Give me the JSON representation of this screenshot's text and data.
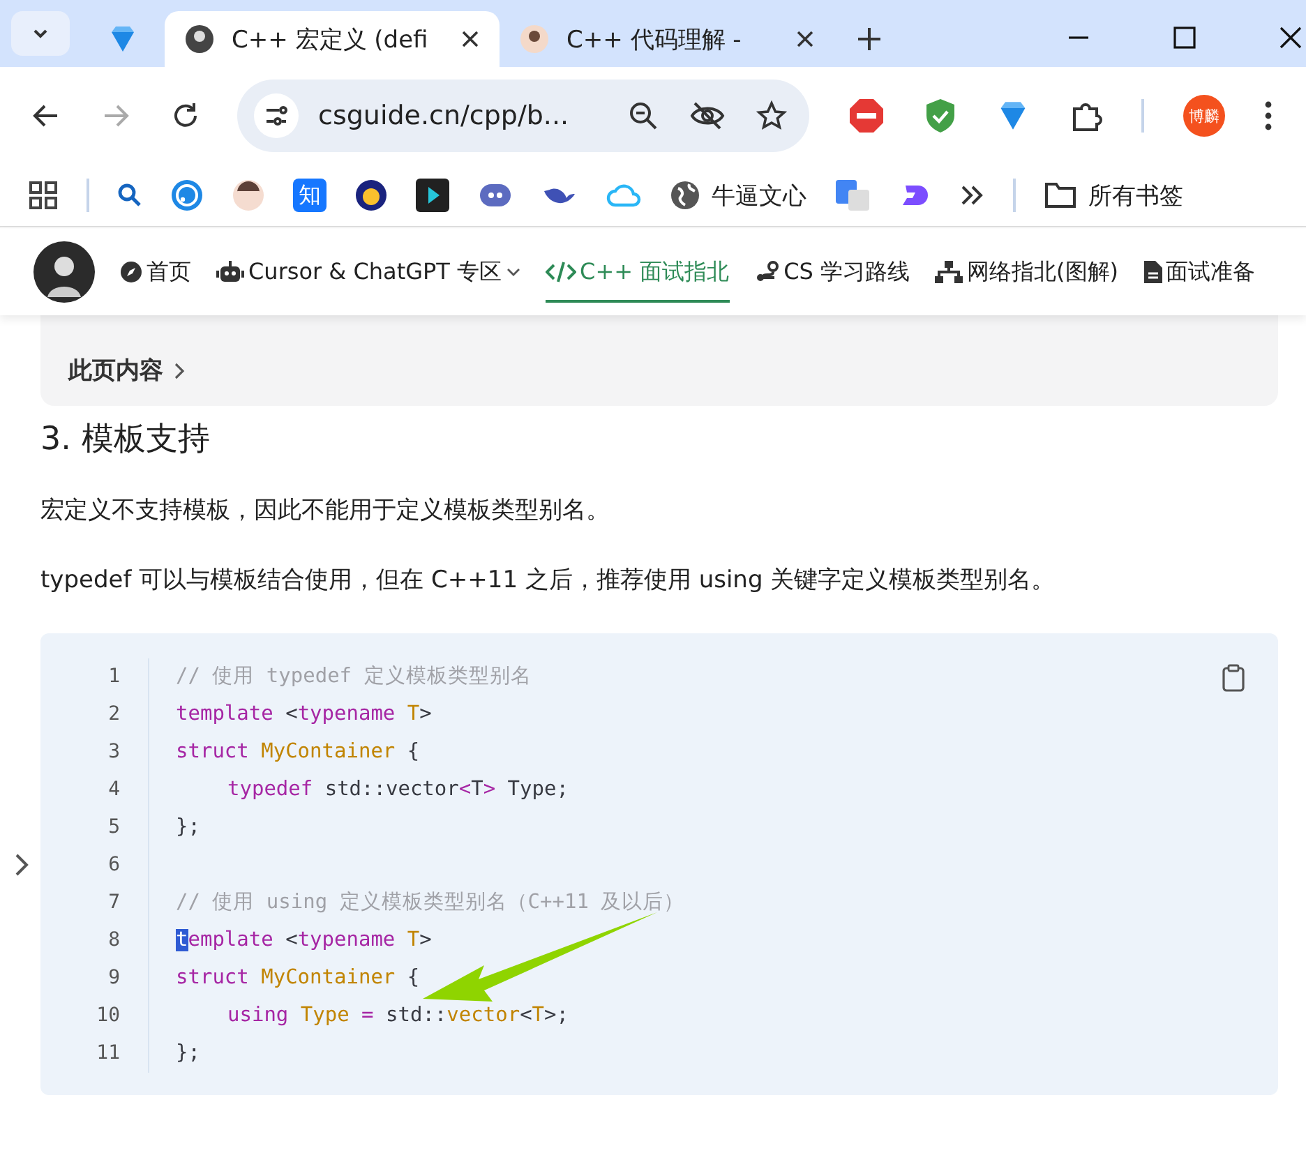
{
  "tabs": [
    {
      "kind": "icon-only",
      "selected": false
    },
    {
      "kind": "page",
      "title": "C++ 宏定义 (defi",
      "selected": true
    },
    {
      "kind": "page",
      "title": "C++ 代码理解 -",
      "selected": false
    }
  ],
  "address": {
    "url": "csguide.cn/cpp/b..."
  },
  "profile": {
    "label": "博麟"
  },
  "bookmarks": [
    {
      "kind": "search"
    },
    {
      "kind": "wifi"
    },
    {
      "kind": "avatar"
    },
    {
      "kind": "zhi",
      "label": "知"
    },
    {
      "kind": "circle"
    },
    {
      "kind": "play"
    },
    {
      "kind": "chat"
    },
    {
      "kind": "whale"
    },
    {
      "kind": "cloud"
    },
    {
      "kind": "globe",
      "label": "牛逼文心"
    },
    {
      "kind": "translate"
    },
    {
      "kind": "d"
    }
  ],
  "all_bookmarks": "所有书签",
  "site_nav": [
    {
      "label": "首页",
      "kind": "compass",
      "selected": false,
      "dropdown": false
    },
    {
      "label": "Cursor & ChatGPT 专区",
      "kind": "robot",
      "selected": false,
      "dropdown": true
    },
    {
      "label": "C++ 面试指北",
      "kind": "code",
      "selected": true,
      "dropdown": false
    },
    {
      "label": "CS 学习路线",
      "kind": "route",
      "selected": false,
      "dropdown": false
    },
    {
      "label": "网络指北(图解)",
      "kind": "network",
      "selected": false,
      "dropdown": false
    },
    {
      "label": "面试准备",
      "kind": "doc",
      "selected": false,
      "dropdown": false
    }
  ],
  "toc": {
    "label": "此页内容"
  },
  "heading": "3. 模板支持",
  "paragraphs": [
    "宏定义不支持模板，因此不能用于定义模板类型别名。",
    "typedef 可以与模板结合使用，但在 C++11 之后，推荐使用 using 关键字定义模板类型别名。"
  ],
  "code": [
    {
      "number": "1",
      "indent": false,
      "tokens": [
        {
          "kind": "comment",
          "t": "// 使用 typedef 定义模板类型别名"
        }
      ]
    },
    {
      "number": "2",
      "indent": false,
      "tokens": [
        {
          "kind": "kw",
          "t": "template"
        },
        {
          "kind": "plain",
          "t": " <"
        },
        {
          "kind": "kw",
          "t": "typename"
        },
        {
          "kind": "type",
          "t": " T"
        },
        {
          "kind": "plain",
          "t": ">"
        }
      ]
    },
    {
      "number": "3",
      "indent": false,
      "tokens": [
        {
          "kind": "kw",
          "t": "struct"
        },
        {
          "kind": "type",
          "t": " MyContainer"
        },
        {
          "kind": "plain",
          "t": " {"
        }
      ]
    },
    {
      "number": "4",
      "indent": true,
      "tokens": [
        {
          "kind": "kw",
          "t": "typedef"
        },
        {
          "kind": "plain",
          "t": " std::vector"
        },
        {
          "kind": "kw",
          "t": "<"
        },
        {
          "kind": "plain",
          "t": "T"
        },
        {
          "kind": "kw",
          "t": ">"
        },
        {
          "kind": "plain",
          "t": " Type;"
        }
      ]
    },
    {
      "number": "5",
      "indent": false,
      "tokens": [
        {
          "kind": "plain",
          "t": "};"
        }
      ]
    },
    {
      "number": "6",
      "indent": false
    },
    {
      "number": "7",
      "indent": false,
      "tokens": [
        {
          "kind": "comment",
          "t": "// 使用 using 定义模板类型别名（C++11 及以后）"
        }
      ]
    },
    {
      "number": "8",
      "indent": false,
      "tokens": [
        {
          "kind": "selected",
          "t": "t"
        },
        {
          "kind": "kw",
          "t": "emplate"
        },
        {
          "kind": "plain",
          "t": " <"
        },
        {
          "kind": "kw",
          "t": "typename"
        },
        {
          "kind": "type",
          "t": " T"
        },
        {
          "kind": "plain",
          "t": ">"
        }
      ]
    },
    {
      "number": "9",
      "indent": false,
      "tokens": [
        {
          "kind": "kw",
          "t": "struct"
        },
        {
          "kind": "type",
          "t": " MyContainer"
        },
        {
          "kind": "plain",
          "t": " {"
        }
      ]
    },
    {
      "number": "10",
      "indent": true,
      "tokens": [
        {
          "kind": "kw",
          "t": "using"
        },
        {
          "kind": "type",
          "t": " Type"
        },
        {
          "kind": "kw",
          "t": " ="
        },
        {
          "kind": "plain",
          "t": " std::"
        },
        {
          "kind": "type",
          "t": "vector"
        },
        {
          "kind": "plain",
          "t": "<"
        },
        {
          "kind": "type",
          "t": "T"
        },
        {
          "kind": "plain",
          "t": ">;"
        }
      ]
    },
    {
      "number": "11",
      "indent": false,
      "tokens": [
        {
          "kind": "plain",
          "t": "};"
        }
      ]
    }
  ]
}
